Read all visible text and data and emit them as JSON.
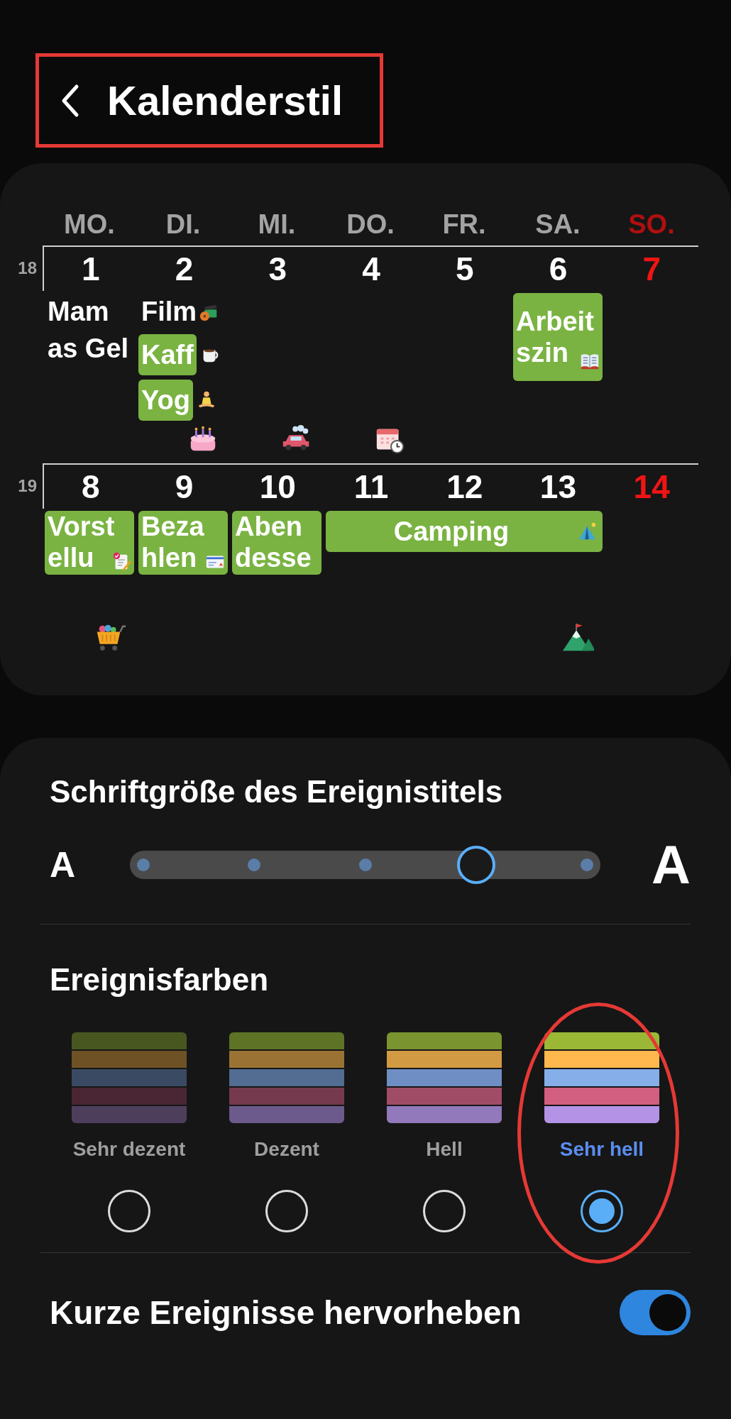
{
  "header": {
    "title": "Kalenderstil",
    "annotated": true
  },
  "calendar": {
    "weekdays": [
      {
        "label": "MO.",
        "sunday": false
      },
      {
        "label": "DI.",
        "sunday": false
      },
      {
        "label": "MI.",
        "sunday": false
      },
      {
        "label": "DO.",
        "sunday": false
      },
      {
        "label": "FR.",
        "sunday": false
      },
      {
        "label": "SA.",
        "sunday": false
      },
      {
        "label": "SO.",
        "sunday": true
      }
    ],
    "weeks": [
      {
        "number": "18",
        "days": [
          {
            "date": "1",
            "sunday": false,
            "events": [
              {
                "kind": "plain",
                "lines": [
                  "Mam",
                  "as Gel"
                ]
              }
            ]
          },
          {
            "date": "2",
            "sunday": false,
            "events": [
              {
                "kind": "plain",
                "lines": [
                  "Film"
                ]
              },
              {
                "kind": "box",
                "lines": [
                  "Kaff"
                ]
              },
              {
                "kind": "box",
                "lines": [
                  "Yog"
                ]
              }
            ]
          },
          {
            "date": "3",
            "sunday": false
          },
          {
            "date": "4",
            "sunday": false
          },
          {
            "date": "5",
            "sunday": false
          },
          {
            "date": "6",
            "sunday": false,
            "events": [
              {
                "kind": "box",
                "lines": [
                  "Arbeit",
                  "szin"
                ]
              }
            ]
          },
          {
            "date": "7",
            "sunday": true
          }
        ]
      },
      {
        "number": "19",
        "days": [
          {
            "date": "8",
            "sunday": false,
            "events": [
              {
                "kind": "box",
                "lines": [
                  "Vorst",
                  "ellu"
                ]
              }
            ]
          },
          {
            "date": "9",
            "sunday": false,
            "events": [
              {
                "kind": "box",
                "lines": [
                  "Beza",
                  "hlen"
                ]
              }
            ]
          },
          {
            "date": "10",
            "sunday": false,
            "events": [
              {
                "kind": "box",
                "lines": [
                  "Aben",
                  "desse"
                ]
              }
            ]
          },
          {
            "date": "11",
            "sunday": false,
            "events": [
              {
                "kind": "bar",
                "lines": [
                  "Camping"
                ]
              }
            ]
          },
          {
            "date": "12",
            "sunday": false,
            "events": [
              {
                "kind": "continued"
              }
            ]
          },
          {
            "date": "13",
            "sunday": false,
            "events": [
              {
                "kind": "continued"
              }
            ]
          },
          {
            "date": "14",
            "sunday": true
          }
        ]
      }
    ]
  },
  "font_size": {
    "title": "Schriftgröße des Ereignistitels",
    "small_label": "A",
    "large_label": "A",
    "level": 0.75
  },
  "event_colors": {
    "title": "Ereignisfarben",
    "options": [
      {
        "label": "Sehr dezent",
        "selected": false,
        "annotated": false
      },
      {
        "label": "Dezent",
        "selected": false,
        "annotated": false
      },
      {
        "label": "Hell",
        "selected": false,
        "annotated": false
      },
      {
        "label": "Sehr hell",
        "selected": true,
        "annotated": true
      }
    ]
  },
  "highlight_short": {
    "label": "Kurze Ereignisse hervorheben",
    "on": true
  }
}
